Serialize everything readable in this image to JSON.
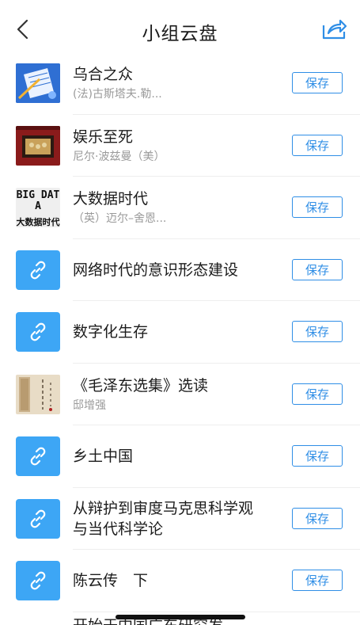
{
  "header": {
    "title": "小组云盘",
    "back_icon": "chevron-left-icon",
    "share_icon": "share-icon",
    "accent": "#2f8ee6"
  },
  "items": [
    {
      "title": "乌合之众",
      "subtitle": "(法)古斯塔夫.勒...",
      "thumb": "book-cover",
      "cover_color": "#2f6fd3"
    },
    {
      "title": "娱乐至死",
      "subtitle": "尼尔·波兹曼（美）",
      "thumb": "book-cover",
      "cover_color": "#8a1b1b"
    },
    {
      "title": "大数据时代",
      "subtitle": "（英）迈尔–舍恩...",
      "thumb": "book-cover",
      "cover_color": "#e9e9e9",
      "cover_text_top": "BIG DATA",
      "cover_text_bottom": "大数据时代"
    },
    {
      "title": "网络时代的意识形态建设",
      "subtitle": "",
      "thumb": "link-icon"
    },
    {
      "title": "数字化生存",
      "subtitle": "",
      "thumb": "link-icon"
    },
    {
      "title": "《毛泽东选集》选读",
      "subtitle": "邸增强",
      "thumb": "book-cover",
      "cover_color": "#d6c3a8"
    },
    {
      "title": "乡土中国",
      "subtitle": "",
      "thumb": "link-icon"
    },
    {
      "title": "从辩护到审度马克思科学观与当代科学论",
      "subtitle": "",
      "thumb": "link-icon"
    },
    {
      "title": "陈云传　下",
      "subtitle": "",
      "thumb": "link-icon"
    }
  ],
  "save_label": "保存",
  "partial_item": "开始于中国广东研究发"
}
